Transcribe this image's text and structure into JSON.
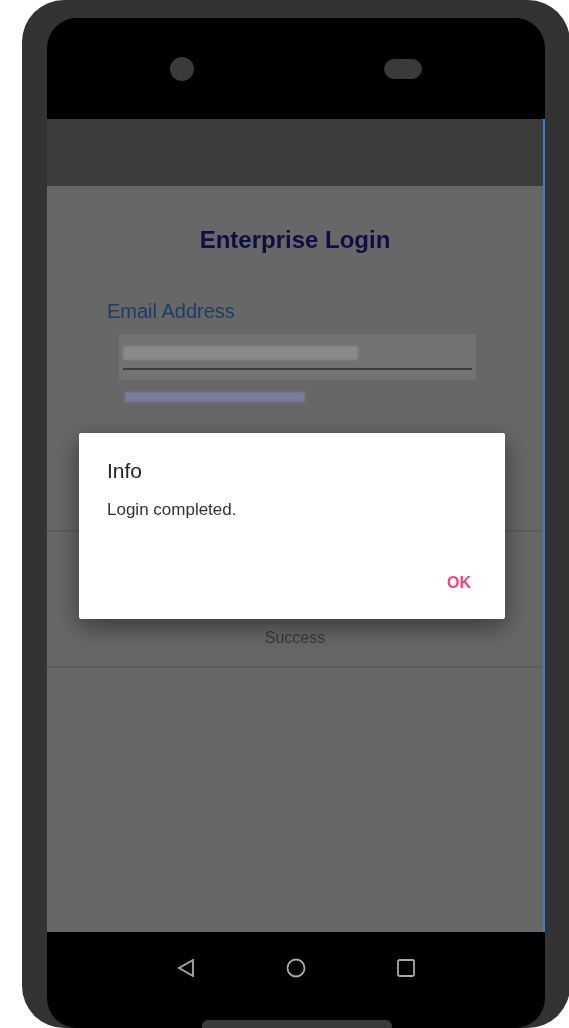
{
  "screen": {
    "title": "Enterprise Login",
    "email_label": "Email Address",
    "status": "Success"
  },
  "dialog": {
    "title": "Info",
    "message": "Login completed.",
    "button": "OK"
  }
}
